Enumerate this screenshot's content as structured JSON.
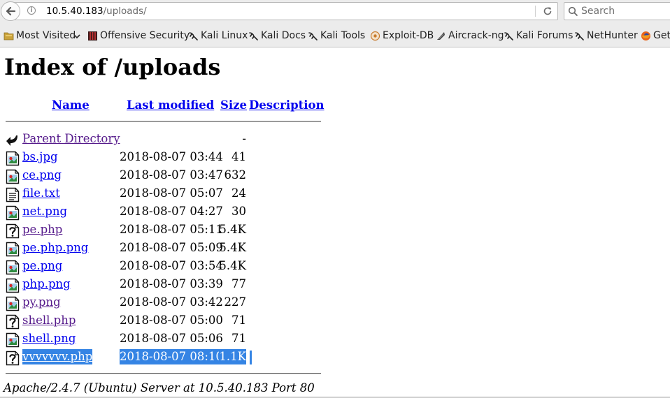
{
  "browser": {
    "url_host": "10.5.40.183",
    "url_path": "/uploads/",
    "search_placeholder": "Search",
    "bookmarks": [
      {
        "label": "Most Visited",
        "icon": "most-visited-icon"
      },
      {
        "label": "Offensive Security",
        "icon": "offsec-icon"
      },
      {
        "label": "Kali Linux",
        "icon": "kali-dragon-icon"
      },
      {
        "label": "Kali Docs",
        "icon": "kali-dragon-icon"
      },
      {
        "label": "Kali Tools",
        "icon": "kali-dragon-icon"
      },
      {
        "label": "Exploit-DB",
        "icon": "exploit-db-icon"
      },
      {
        "label": "Aircrack-ng",
        "icon": "aircrack-icon"
      },
      {
        "label": "Kali Forums",
        "icon": "kali-dragon-icon"
      },
      {
        "label": "NetHunter",
        "icon": "kali-dragon-icon"
      },
      {
        "label": "Get",
        "icon": "firefox-icon"
      }
    ]
  },
  "page": {
    "title": "Index of /uploads",
    "columns": [
      "Name",
      "Last modified",
      "Size",
      "Description"
    ],
    "parent": {
      "name": "Parent Directory",
      "size": "-"
    },
    "files": [
      {
        "name": "bs.jpg",
        "modified": "2018-08-07 03:44",
        "size": "41",
        "type": "image",
        "visited": false,
        "selected": false
      },
      {
        "name": "ce.png",
        "modified": "2018-08-07 03:47",
        "size": "632",
        "type": "image",
        "visited": false,
        "selected": false
      },
      {
        "name": "file.txt",
        "modified": "2018-08-07 05:07",
        "size": "24",
        "type": "text",
        "visited": false,
        "selected": false
      },
      {
        "name": "net.png",
        "modified": "2018-08-07 04:27",
        "size": "30",
        "type": "image",
        "visited": false,
        "selected": false
      },
      {
        "name": "pe.php",
        "modified": "2018-08-07 05:11",
        "size": "5.4K",
        "type": "unknown",
        "visited": true,
        "selected": false
      },
      {
        "name": "pe.php.png",
        "modified": "2018-08-07 05:09",
        "size": "5.4K",
        "type": "image",
        "visited": false,
        "selected": false
      },
      {
        "name": "pe.png",
        "modified": "2018-08-07 03:54",
        "size": "5.4K",
        "type": "image",
        "visited": false,
        "selected": false
      },
      {
        "name": "php.png",
        "modified": "2018-08-07 03:39",
        "size": "77",
        "type": "image",
        "visited": false,
        "selected": false
      },
      {
        "name": "py.png",
        "modified": "2018-08-07 03:42",
        "size": "227",
        "type": "image",
        "visited": true,
        "selected": false
      },
      {
        "name": "shell.php",
        "modified": "2018-08-07 05:00",
        "size": "71",
        "type": "unknown",
        "visited": true,
        "selected": false
      },
      {
        "name": "shell.png",
        "modified": "2018-08-07 05:06",
        "size": "71",
        "type": "image",
        "visited": false,
        "selected": false
      },
      {
        "name": "vvvvvvv.php",
        "modified": "2018-08-07 08:10",
        "size": "1.1K",
        "type": "unknown",
        "visited": false,
        "selected": true
      }
    ],
    "server_signature": "Apache/2.4.7 (Ubuntu) Server at 10.5.40.183 Port 80"
  },
  "colors": {
    "link": "#0000ee",
    "visited": "#551a8b",
    "selection": "#3584e4",
    "chrome": "#ececec"
  }
}
